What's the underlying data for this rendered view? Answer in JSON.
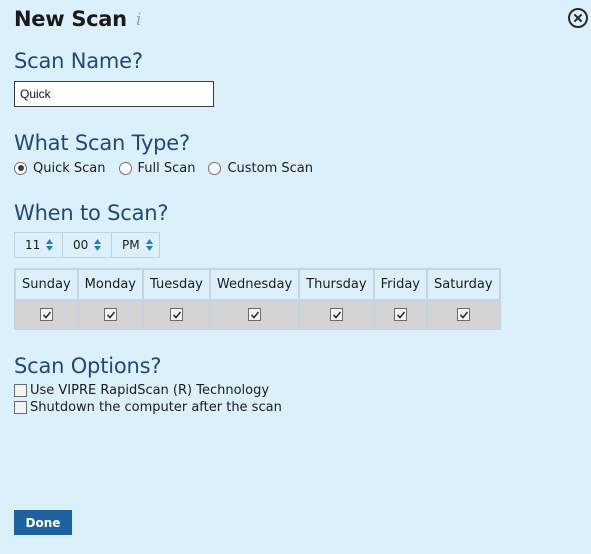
{
  "dialog": {
    "title": "New Scan",
    "info_glyph": "i",
    "close_icon": "close-icon"
  },
  "scan_name": {
    "heading": "Scan Name?",
    "value": "Quick",
    "placeholder": ""
  },
  "scan_type": {
    "heading": "What Scan Type?",
    "options": [
      {
        "label": "Quick Scan",
        "selected": true
      },
      {
        "label": "Full Scan",
        "selected": false
      },
      {
        "label": "Custom Scan",
        "selected": false
      }
    ]
  },
  "schedule": {
    "heading": "When to Scan?",
    "hour": "11",
    "minute": "00",
    "ampm": "PM",
    "days": [
      {
        "label": "Sunday",
        "checked": true
      },
      {
        "label": "Monday",
        "checked": true
      },
      {
        "label": "Tuesday",
        "checked": true
      },
      {
        "label": "Wednesday",
        "checked": true
      },
      {
        "label": "Thursday",
        "checked": true
      },
      {
        "label": "Friday",
        "checked": true
      },
      {
        "label": "Saturday",
        "checked": true
      }
    ]
  },
  "scan_options": {
    "heading": "Scan Options?",
    "items": [
      {
        "label": "Use VIPRE RapidScan (R) Technology",
        "checked": false
      },
      {
        "label": "Shutdown the computer after the scan",
        "checked": false
      }
    ]
  },
  "footer": {
    "done_label": "Done"
  },
  "colors": {
    "background": "#dcf0fc",
    "heading": "#1f4b73",
    "primary_button": "#1d629d",
    "spinner_arrow": "#2b7bb5"
  }
}
